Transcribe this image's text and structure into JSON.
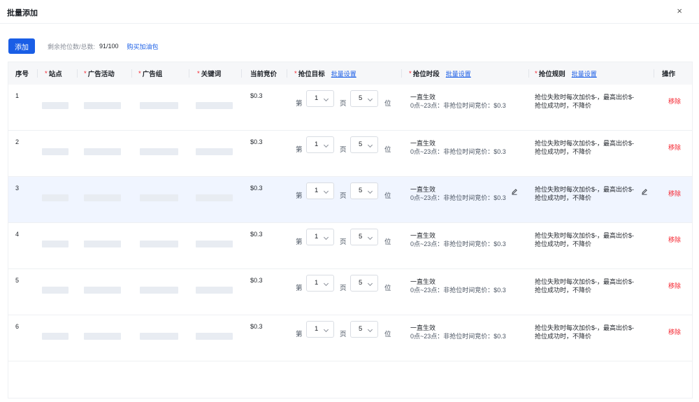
{
  "modal": {
    "title": "批量添加",
    "close_glyph": "×"
  },
  "toolbar": {
    "add_label": "添加",
    "quota_label": "剩余抢位数/总数:",
    "quota_value": "91/100",
    "buy_link": "购买加油包"
  },
  "table": {
    "columns": {
      "index": "序号",
      "site": "站点",
      "campaign": "广告活动",
      "ad_group": "广告组",
      "keyword": "关键词",
      "current_bid": "当前竞价",
      "target": "抢位目标",
      "period": "抢位时段",
      "rule": "抢位规则",
      "action": "操作"
    },
    "required_mark": "*",
    "batch_set_label": "批量设置",
    "cell_texts": {
      "page_prefix": "第",
      "page_unit": "页",
      "position_unit": "位",
      "period_title": "一直生效",
      "period_desc": "0点~23点：非抢位时间竞价：$0.3",
      "rule_line1": "抢位失败时每次加价$-，最高出价$-",
      "rule_line2": "抢位成功时，不降价",
      "remove_label": "移除"
    },
    "rows": [
      {
        "index": "1",
        "bid": "$0.3",
        "page": "1",
        "position": "5"
      },
      {
        "index": "2",
        "bid": "$0.3",
        "page": "1",
        "position": "5"
      },
      {
        "index": "3",
        "bid": "$0.3",
        "page": "1",
        "position": "5"
      },
      {
        "index": "4",
        "bid": "$0.3",
        "page": "1",
        "position": "5"
      },
      {
        "index": "5",
        "bid": "$0.3",
        "page": "1",
        "position": "5"
      },
      {
        "index": "6",
        "bid": "$0.3",
        "page": "1",
        "position": "5"
      }
    ],
    "hover_row_index": 2
  },
  "colors": {
    "primary": "#1a5ee6",
    "danger": "#f5222d",
    "hover_row_bg": "#f0f5ff",
    "header_bg": "#f6f7f9",
    "placeholder_bar": "#e8ecf2"
  },
  "icons": {
    "edit": "pencil-icon",
    "close": "close-icon",
    "dropdown": "chevron-down-icon"
  }
}
